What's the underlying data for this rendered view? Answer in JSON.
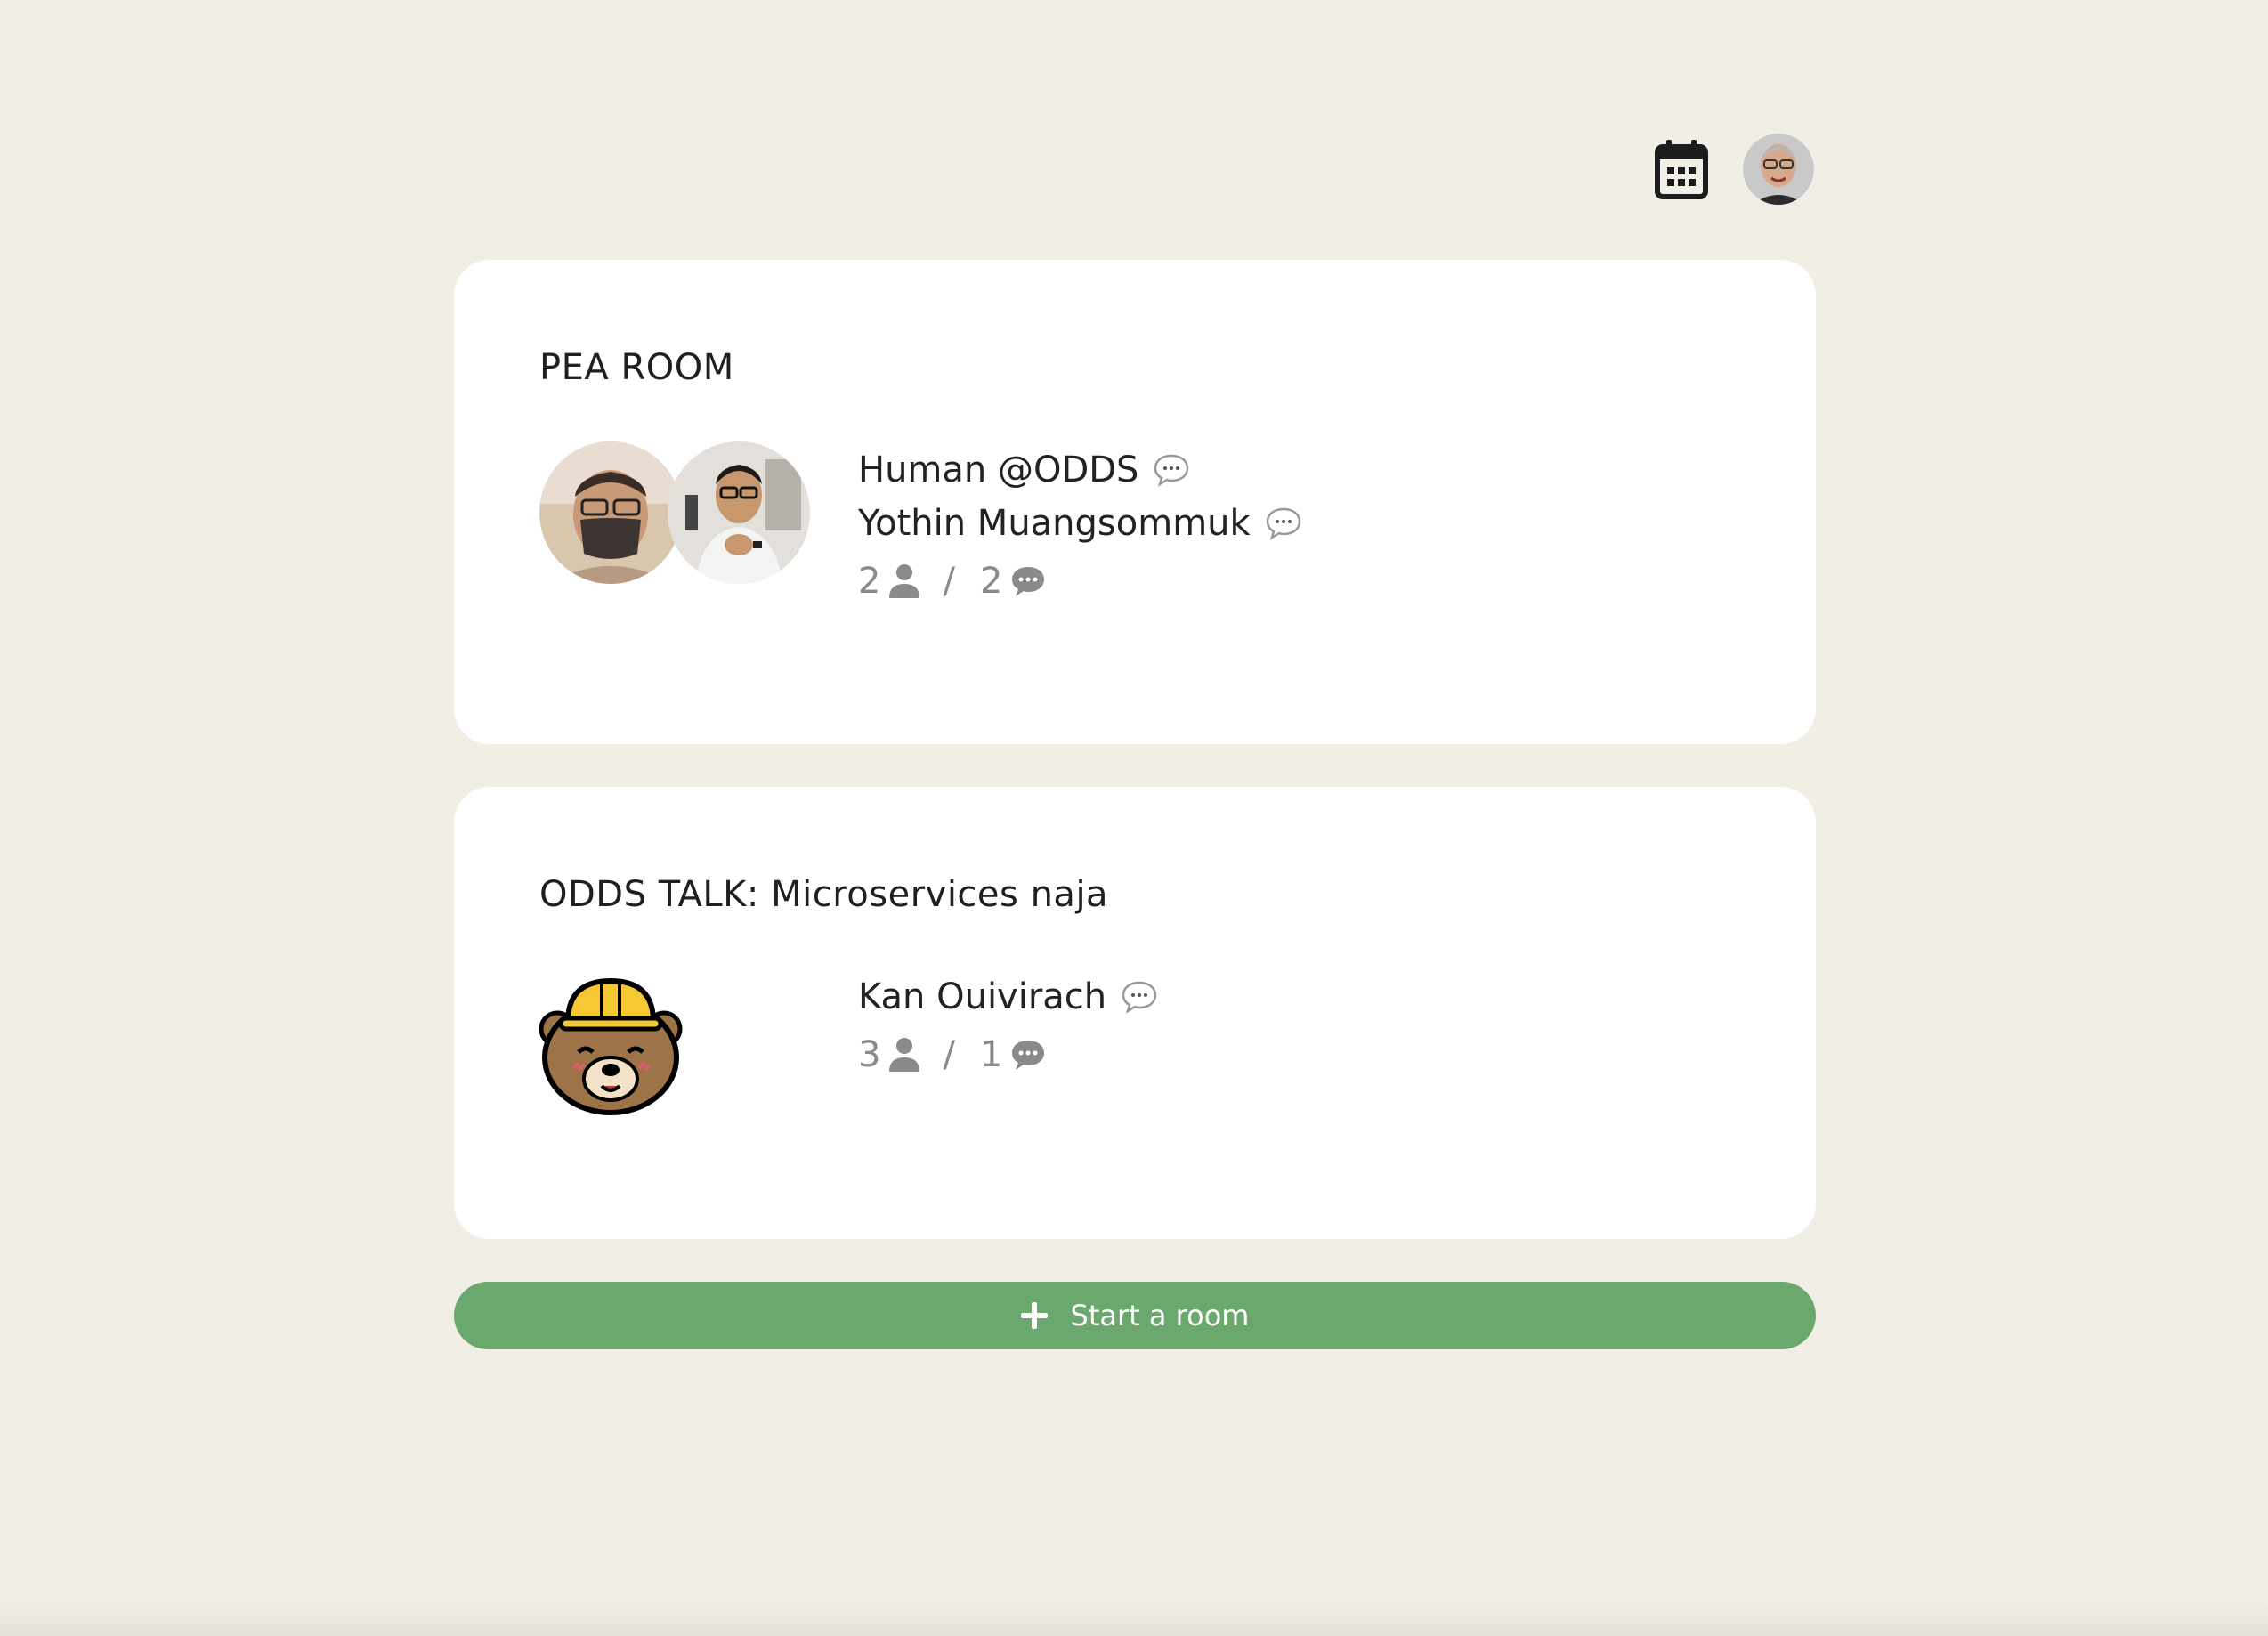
{
  "header": {
    "calendar_icon": "calendar-icon",
    "profile_avatar": "user-avatar"
  },
  "rooms": [
    {
      "title": "PEA ROOM",
      "speakers": [
        {
          "name": "Human @ODDS",
          "icon": "chat-bubble-icon"
        },
        {
          "name": "Yothin Muangsommuk",
          "icon": "chat-bubble-icon"
        }
      ],
      "listeners": "2",
      "speaker_count": "2",
      "separator": "/"
    },
    {
      "title": "ODDS TALK: Microservices naja",
      "speakers": [
        {
          "name": "Kan Ouivirach",
          "icon": "chat-bubble-icon"
        }
      ],
      "listeners": "3",
      "speaker_count": "1",
      "separator": "/"
    }
  ],
  "start_button": {
    "label": "Start a room",
    "icon": "plus-icon"
  },
  "colors": {
    "background": "#f1eee6",
    "card": "#ffffff",
    "accent": "#6aa86d",
    "muted": "#8a8a8a"
  }
}
